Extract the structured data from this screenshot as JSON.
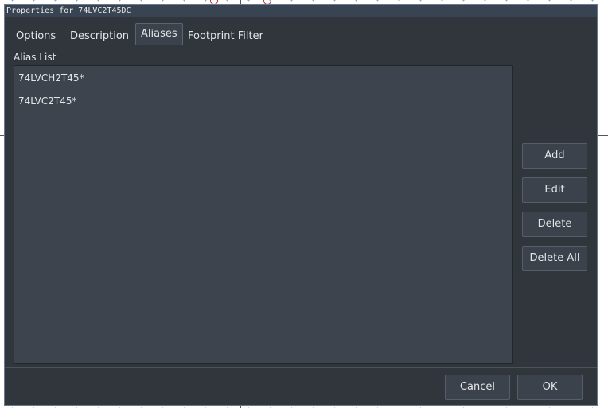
{
  "dialog": {
    "title": "Properties for 74LVC2T45DC"
  },
  "tabs": [
    {
      "label": "Options"
    },
    {
      "label": "Description"
    },
    {
      "label": "Aliases"
    },
    {
      "label": "Footprint Filter"
    }
  ],
  "aliases": {
    "group_label": "Alias List",
    "items": [
      "74LVCH2T45*",
      "74LVC2T45*"
    ],
    "buttons": {
      "add": "Add",
      "edit": "Edit",
      "delete": "Delete",
      "delete_all": "Delete All"
    }
  },
  "footer": {
    "cancel": "Cancel",
    "ok": "OK"
  }
}
